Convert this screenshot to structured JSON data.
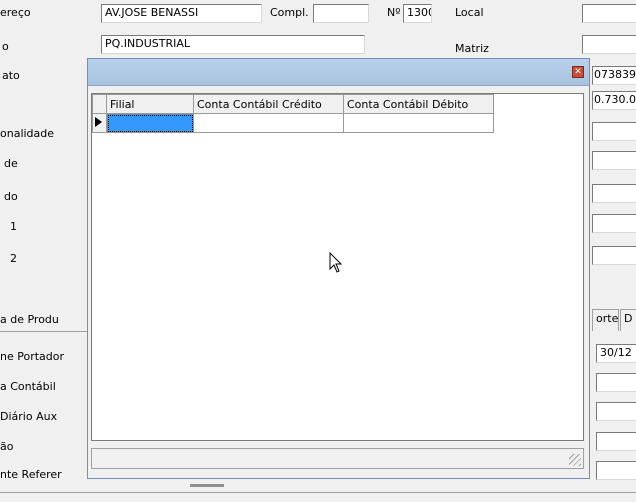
{
  "form": {
    "labels": {
      "endereco": "ereço",
      "bairro": "o",
      "contato": "ato",
      "nacionalidade": "onalidade",
      "cidade": "de",
      "estado": "do",
      "fone1": "1",
      "fone2": "2",
      "tabela_produtos": "a de Produ",
      "nome_portador": "ne Portador",
      "conta_contabil": "a Contábil",
      "diario_aux": "Diário Aux",
      "emissao": "ão",
      "conta_referencia": "nte Referer",
      "compl": "Compl.",
      "numero": "Nº",
      "local": "Local",
      "matriz": "Matriz"
    },
    "values": {
      "endereco": "AV.JOSE BENASSI",
      "numero": "1300",
      "bairro": "PQ.INDUSTRIAL",
      "right_field_1": "073839",
      "right_field_2": "0.730.0",
      "date": "30/12"
    },
    "tabs": [
      "orte",
      "D"
    ]
  },
  "dialog": {
    "title": "",
    "close_glyph": "✕",
    "grid": {
      "columns": [
        "Filial",
        "Conta Contábil Crédito",
        "Conta Contábil Débito"
      ],
      "rows": [
        [
          "",
          "",
          ""
        ]
      ]
    }
  }
}
